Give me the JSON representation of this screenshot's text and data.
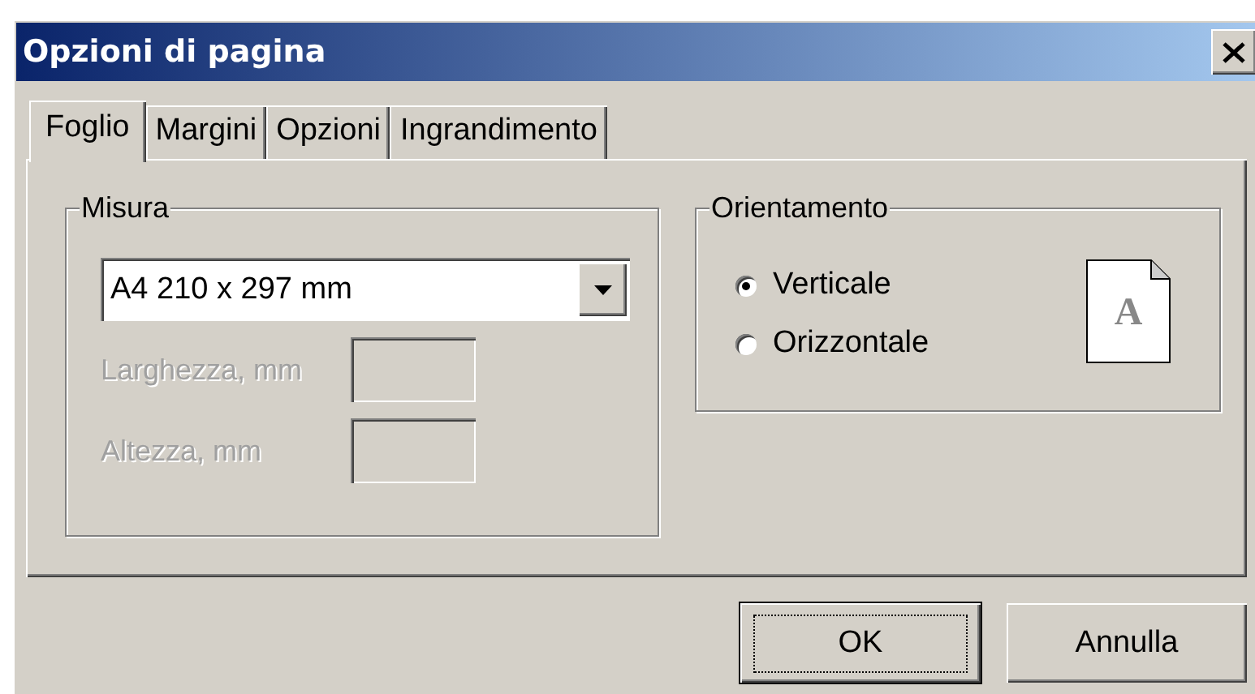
{
  "window": {
    "title": "Opzioni di pagina"
  },
  "tabs": [
    {
      "label": "Foglio",
      "selected": true
    },
    {
      "label": "Margini",
      "selected": false
    },
    {
      "label": "Opzioni",
      "selected": false
    },
    {
      "label": "Ingrandimento",
      "selected": false
    }
  ],
  "size_group": {
    "title": "Misura",
    "paper": {
      "value": "A4 210 x 297 mm"
    },
    "fields": [
      {
        "label": "Larghezza, mm",
        "disabled": true
      },
      {
        "label": "Altezza, mm",
        "disabled": true
      }
    ]
  },
  "orientation_group": {
    "title": "Orientamento",
    "preview_letter": "A",
    "options": [
      {
        "label": "Verticale",
        "selected": true
      },
      {
        "label": "Orizzontale",
        "selected": false
      }
    ]
  },
  "buttons": [
    {
      "label": "OK",
      "default": true
    },
    {
      "label": "Annulla",
      "default": false
    }
  ]
}
